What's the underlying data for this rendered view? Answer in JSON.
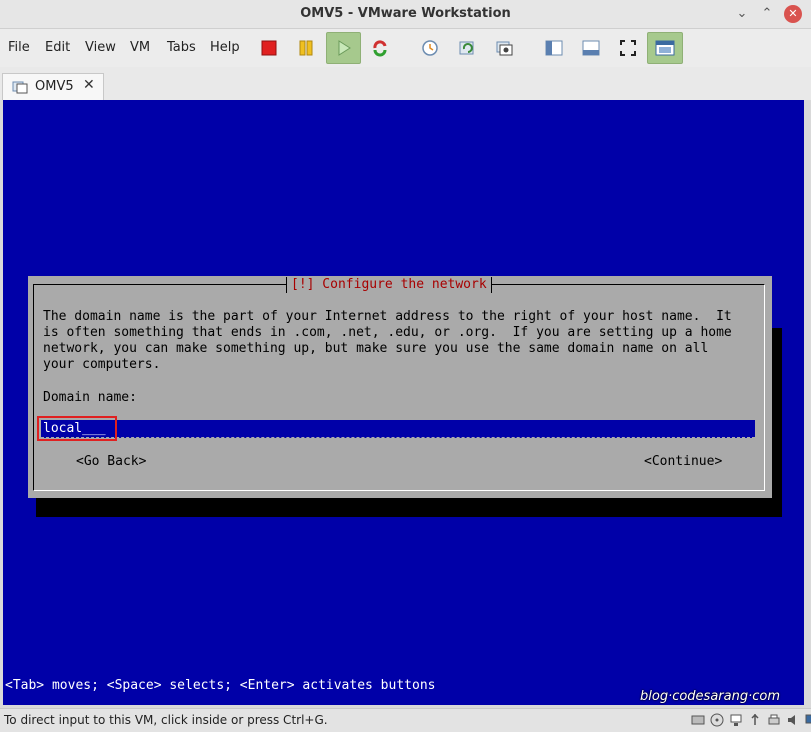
{
  "window": {
    "title": "OMV5 - VMware Workstation",
    "minimize_glyph": "⌄",
    "maximize_glyph": "⌃",
    "close_glyph": "✕"
  },
  "menu": [
    "File",
    "Edit",
    "View",
    "VM",
    "Tabs",
    "Help"
  ],
  "toolbar": [
    {
      "icon": "power-off-icon",
      "color": "#e02020"
    },
    {
      "icon": "suspend-icon",
      "color": "#f0c020"
    },
    {
      "icon": "power-on-icon",
      "color": "#3aa83a"
    },
    {
      "icon": "reset-icon",
      "color": "#d03030"
    },
    {
      "icon": "snapshot-icon"
    },
    {
      "icon": "revert-snapshot-icon"
    },
    {
      "icon": "snapshot-manager-icon"
    },
    {
      "icon": "library-icon"
    },
    {
      "icon": "thumbnail-bar-icon"
    },
    {
      "icon": "full-screen-icon"
    },
    {
      "icon": "unity-icon"
    }
  ],
  "tab": {
    "label": "OMV5",
    "close": "✕"
  },
  "installer": {
    "dialog_title": "[!] Configure the network",
    "description": "The domain name is the part of your Internet address to the right of your host name.  It\nis often something that ends in .com, .net, .edu, or .org.  If you are setting up a home\nnetwork, you can make something up, but make sure you use the same domain name on all\nyour computers.",
    "field_label": "Domain name:",
    "field_value": "local___",
    "go_back": "<Go Back>",
    "continue": "<Continue>",
    "help_line": "<Tab> moves; <Space> selects; <Enter> activates buttons"
  },
  "watermark": "blog·codesarang·com",
  "status": {
    "message": "To direct input to this VM, click inside or press Ctrl+G."
  }
}
